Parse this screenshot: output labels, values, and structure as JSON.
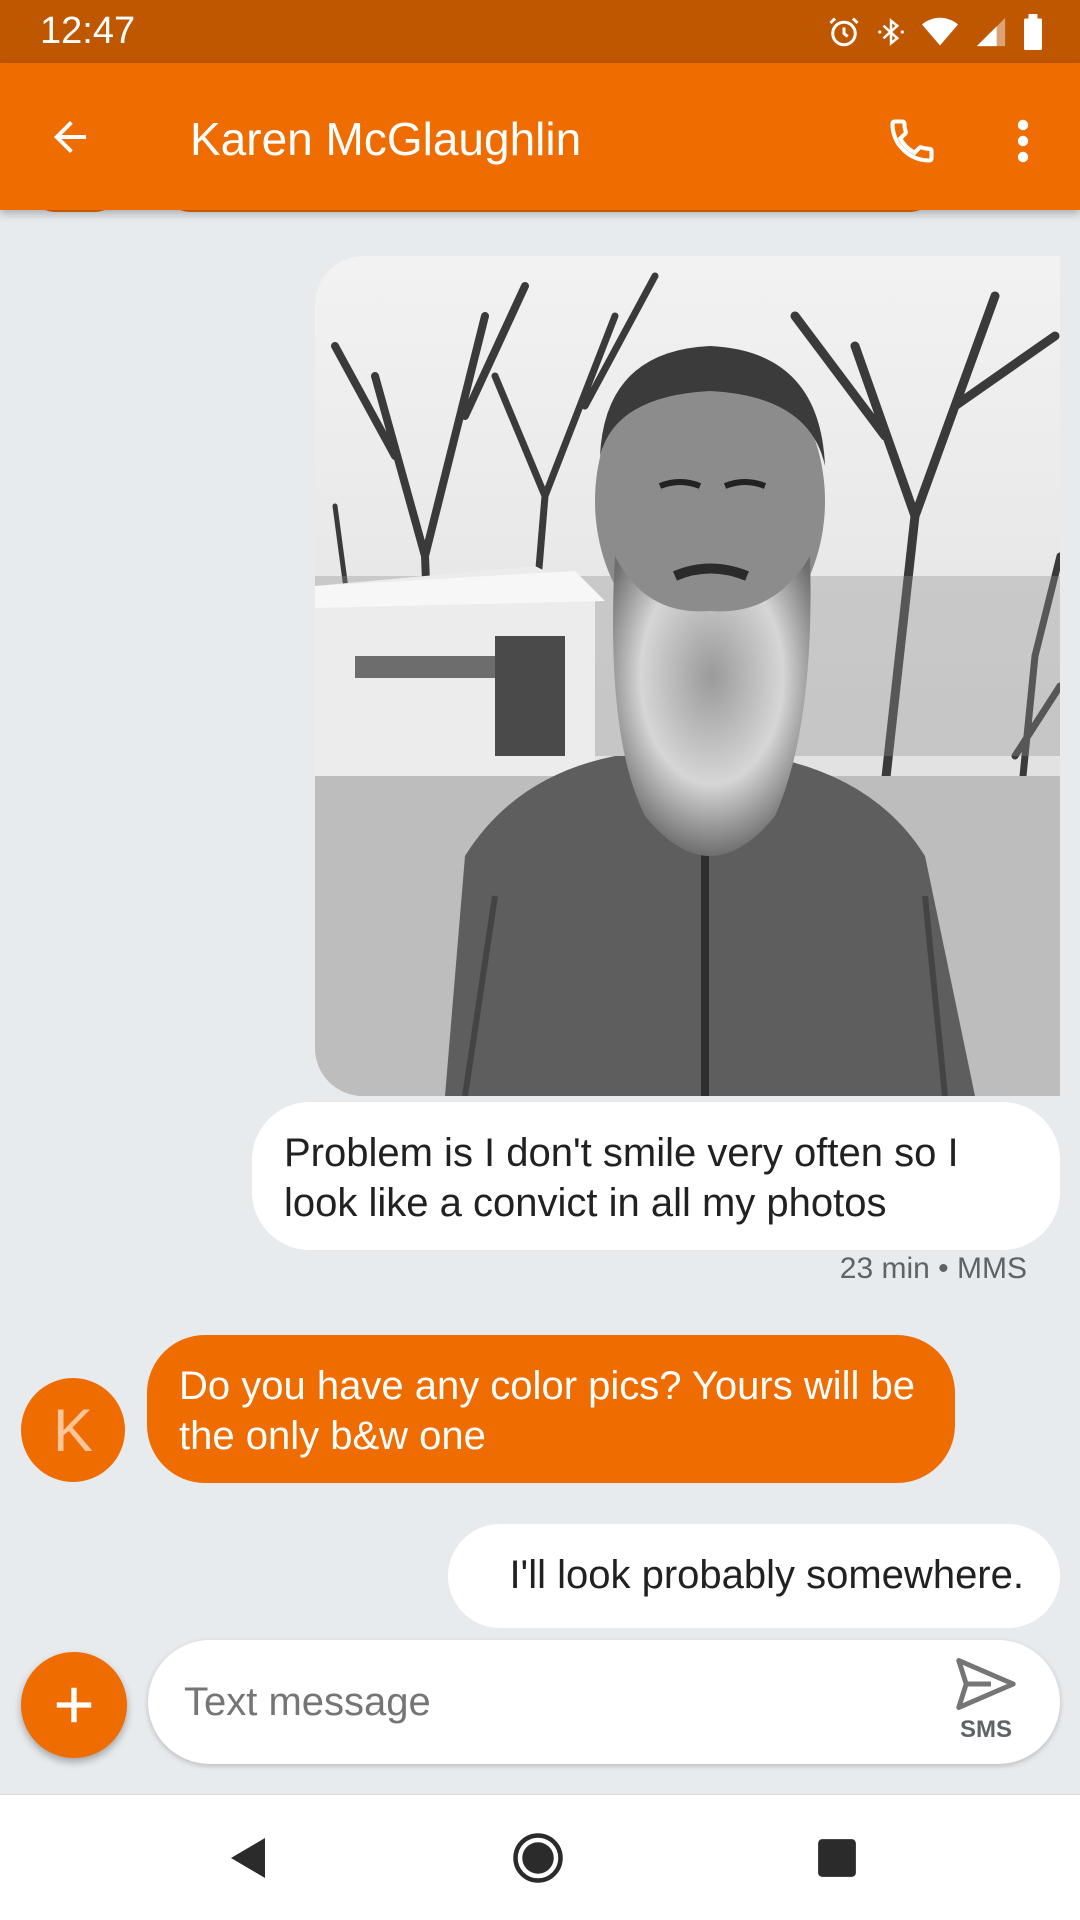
{
  "status_bar": {
    "time": "12:47"
  },
  "header": {
    "title": "Karen McGlaughlin"
  },
  "conversation": {
    "outgoing_1": "Problem is I don't smile very often so I look like a convict in all my photos",
    "outgoing_1_meta": "23 min • MMS",
    "incoming_avatar_letter": "K",
    "incoming_1": "Do you have any color pics? Yours will be the only b&w one",
    "outgoing_2": "I'll look probably somewhere."
  },
  "compose": {
    "placeholder": "Text message",
    "send_label": "SMS"
  },
  "colors": {
    "accent": "#ef6c00",
    "status_bar": "#bf5600",
    "background": "#e8ebee"
  }
}
